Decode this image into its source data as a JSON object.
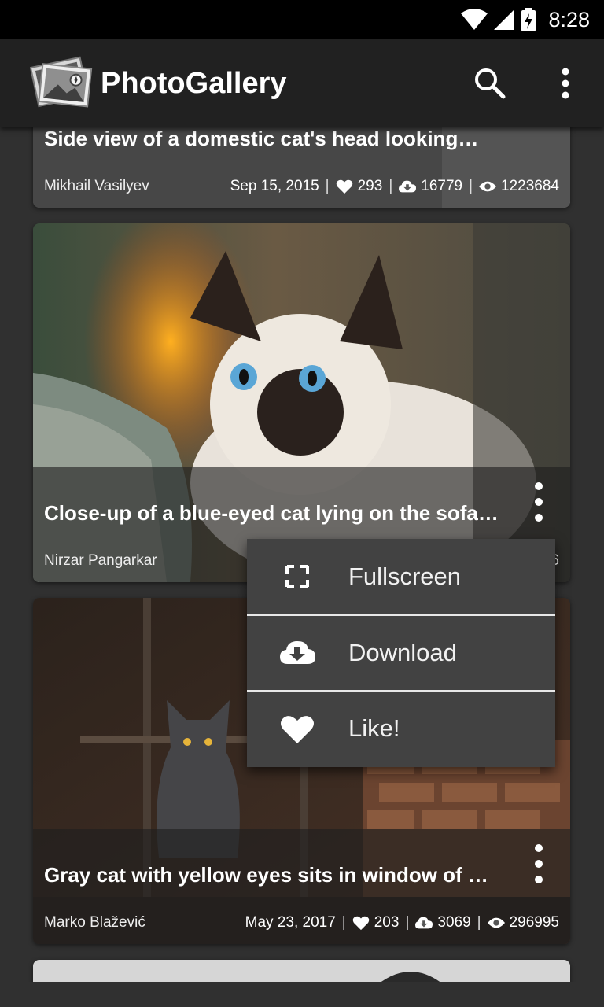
{
  "status_bar": {
    "time": "8:28"
  },
  "app_bar": {
    "title": "PhotoGallery",
    "logo_icon": "photo-stack-logo-icon",
    "search_icon": "search-icon",
    "overflow_icon": "more-vert-icon"
  },
  "photos": [
    {
      "title": "Side view of a domestic cat's head looking…",
      "author": "Mikhail Vasilyev",
      "date": "Sep 15, 2015",
      "likes": "293",
      "downloads": "16779",
      "views": "1223684"
    },
    {
      "title": "Close-up of a blue-eyed cat lying on the sofa…",
      "author": "Nirzar Pangarkar",
      "views_partial": "6"
    },
    {
      "title": "Gray cat with yellow eyes sits in window of o…",
      "author": "Marko Blažević",
      "date": "May 23, 2017",
      "likes": "203",
      "downloads": "3069",
      "views": "296995"
    }
  ],
  "stats_separator": "|",
  "popup_menu": [
    {
      "label": "Fullscreen",
      "icon": "fullscreen-icon"
    },
    {
      "label": "Download",
      "icon": "cloud-download-icon"
    },
    {
      "label": "Like!",
      "icon": "heart-icon"
    }
  ],
  "colors": {
    "background": "#303030",
    "app_bar": "#212121",
    "popup": "#424242"
  }
}
